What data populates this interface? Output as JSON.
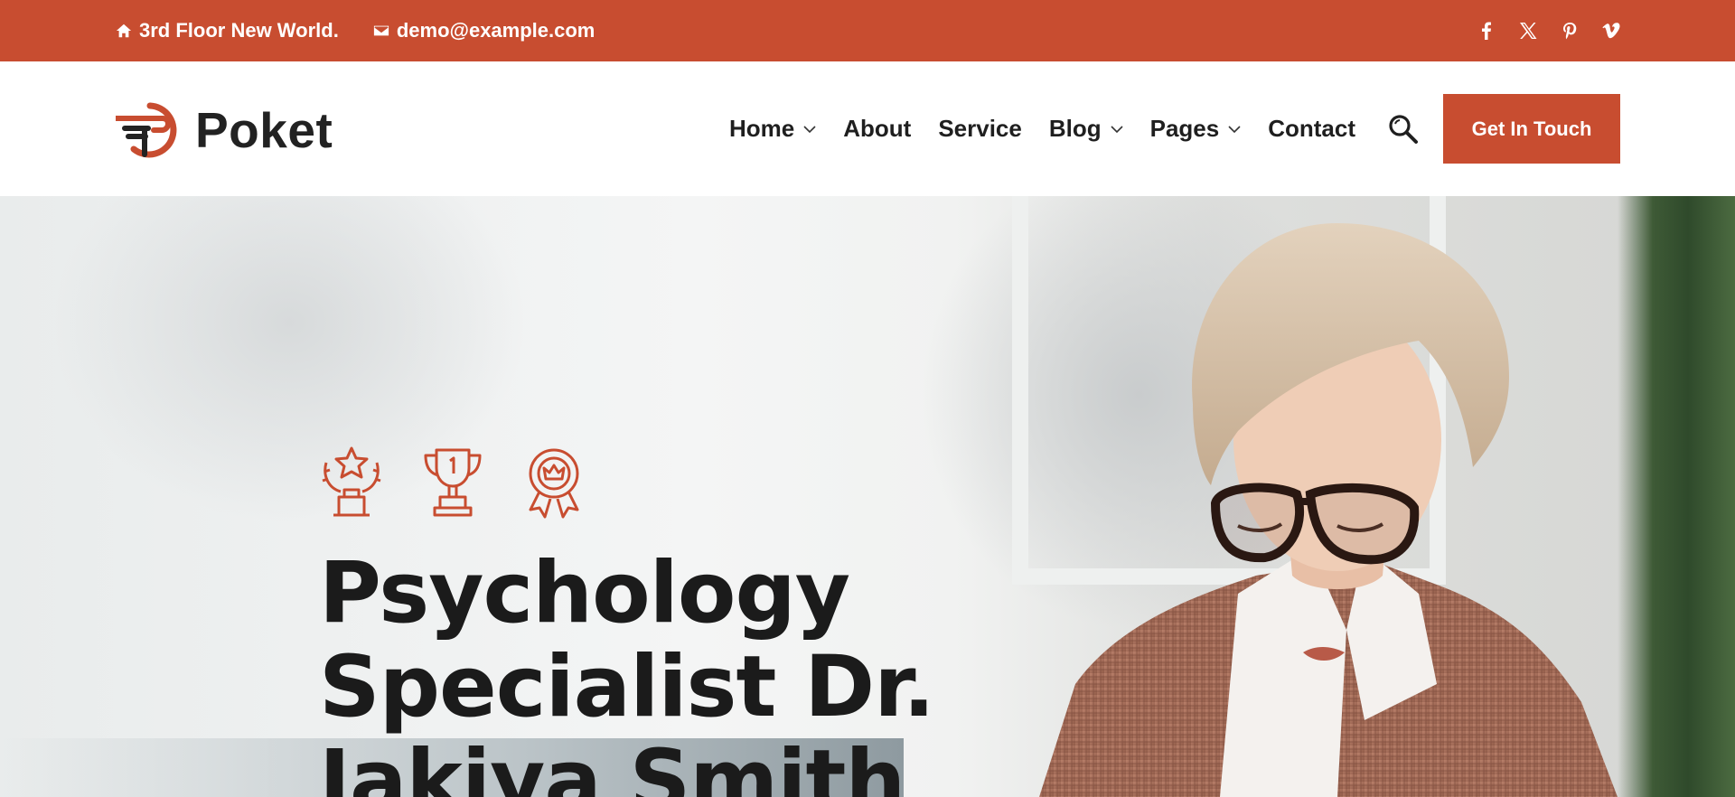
{
  "topbar": {
    "address": "3rd Floor New World.",
    "email": "demo@example.com",
    "social": [
      "facebook-icon",
      "x-icon",
      "pinterest-icon",
      "vimeo-icon"
    ]
  },
  "header": {
    "logo_text": "Poket",
    "nav": [
      {
        "label": "Home",
        "dropdown": true
      },
      {
        "label": "About",
        "dropdown": false
      },
      {
        "label": "Service",
        "dropdown": false
      },
      {
        "label": "Blog",
        "dropdown": true
      },
      {
        "label": "Pages",
        "dropdown": true
      },
      {
        "label": "Contact",
        "dropdown": false
      }
    ],
    "cta_label": "Get In Touch"
  },
  "hero": {
    "awards": [
      "star-trophy-icon",
      "number-one-trophy-icon",
      "medal-ribbon-icon"
    ],
    "title_line1": "Psychology",
    "title_line2": "Specialist Dr.",
    "title_line3": "Jakiya Smith"
  },
  "colors": {
    "accent": "#c84d30",
    "text_dark": "#1b1b1b"
  }
}
